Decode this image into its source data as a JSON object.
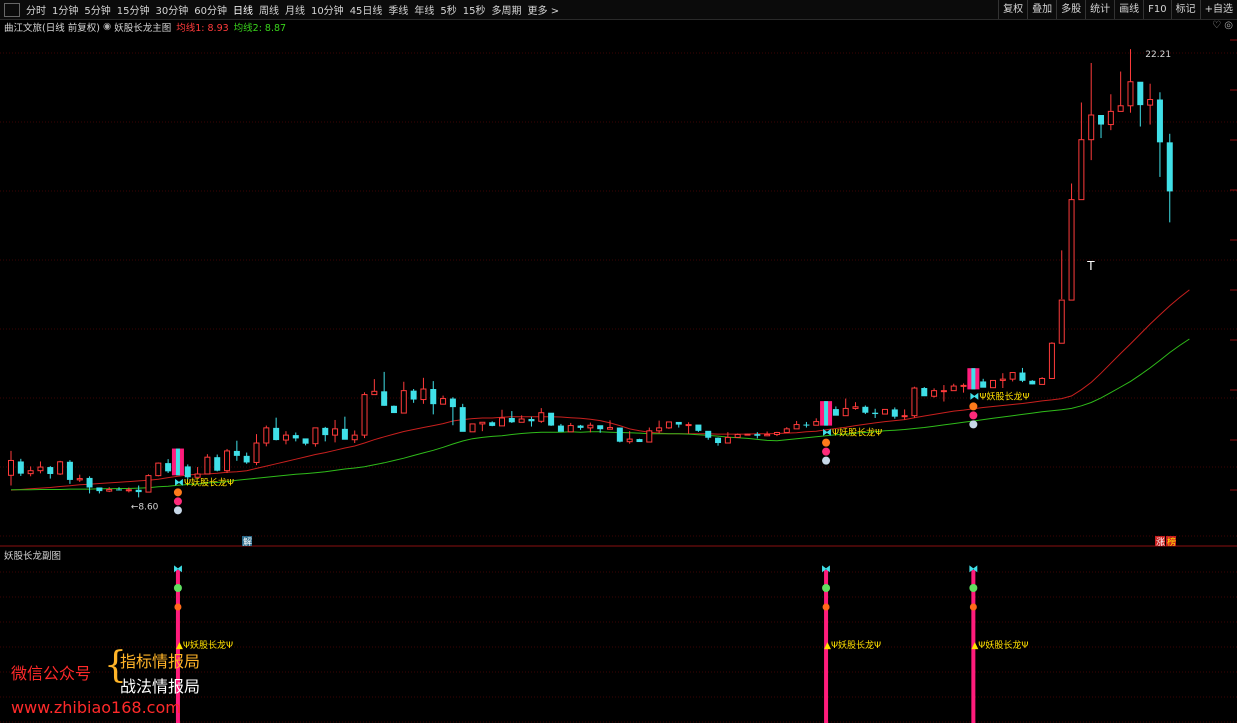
{
  "toolbar": {
    "left_items": [
      "分时",
      "1分钟",
      "5分钟",
      "15分钟",
      "30分钟",
      "60分钟",
      "日线",
      "周线",
      "月线",
      "10分钟",
      "45日线",
      "季线",
      "年线",
      "5秒",
      "15秒",
      "多周期",
      "更多 >"
    ],
    "active_item": "日线",
    "right_items": [
      "复权",
      "叠加",
      "多股",
      "统计",
      "画线",
      "F10",
      "标记",
      "+自选"
    ]
  },
  "title": {
    "stock": "曲江文旅(日线 前复权)",
    "indicator": "妖股长龙主图",
    "ma1": "均线1: 8.93",
    "ma2": "均线2: 8.87",
    "icons": "♡ ◎"
  },
  "sub": {
    "title": "妖股长龙副图"
  },
  "colors": {
    "up": "#ff3b3b",
    "down": "#40e0e8",
    "ma1": "#c8201e",
    "ma2": "#2fbb1a",
    "signal_bar": "#ff1c7c",
    "signal_text": "#ffe000",
    "grid": "#7a0a0a"
  },
  "chart_data": {
    "type": "candlestick",
    "ylim": [
      7.7,
      22.7
    ],
    "candles": [
      [
        9.27,
        9.72,
        8.96,
        10.01
      ],
      [
        9.69,
        9.32,
        9.25,
        9.77
      ],
      [
        9.32,
        9.41,
        9.24,
        9.54
      ],
      [
        9.41,
        9.52,
        9.33,
        9.69
      ],
      [
        9.52,
        9.31,
        9.17,
        9.55
      ],
      [
        9.31,
        9.68,
        9.28,
        9.71
      ],
      [
        9.68,
        9.13,
        9.01,
        9.73
      ],
      [
        9.13,
        9.17,
        9.07,
        9.29
      ],
      [
        9.19,
        8.9,
        8.72,
        9.24
      ],
      [
        8.9,
        8.79,
        8.72,
        8.9
      ],
      [
        8.79,
        8.84,
        8.76,
        8.91
      ],
      [
        8.84,
        8.82,
        8.81,
        8.91
      ],
      [
        8.82,
        8.83,
        8.75,
        8.9
      ],
      [
        8.83,
        8.76,
        8.6,
        8.96
      ],
      [
        8.76,
        9.26,
        8.75,
        9.3
      ],
      [
        9.26,
        9.64,
        9.24,
        9.66
      ],
      [
        9.64,
        9.39,
        9.34,
        9.76
      ],
      [
        9.39,
        9.54,
        9.31,
        9.9
      ],
      [
        9.54,
        9.21,
        9.15,
        9.6
      ],
      [
        9.21,
        9.31,
        9.22,
        9.52
      ],
      [
        9.31,
        9.82,
        9.3,
        9.91
      ],
      [
        9.82,
        9.41,
        9.39,
        9.9
      ],
      [
        9.41,
        10.01,
        9.34,
        10.07
      ],
      [
        10.01,
        9.86,
        9.71,
        10.32
      ],
      [
        9.86,
        9.66,
        9.62,
        9.96
      ],
      [
        9.66,
        10.25,
        9.58,
        10.52
      ],
      [
        10.25,
        10.71,
        10.15,
        10.78
      ],
      [
        10.71,
        10.34,
        10.33,
        11.02
      ],
      [
        10.34,
        10.49,
        10.21,
        10.61
      ],
      [
        10.49,
        10.39,
        10.3,
        10.57
      ],
      [
        10.39,
        10.23,
        10.18,
        10.36
      ],
      [
        10.23,
        10.71,
        10.14,
        10.72
      ],
      [
        10.71,
        10.49,
        10.3,
        10.74
      ],
      [
        10.49,
        10.68,
        10.27,
        10.95
      ],
      [
        10.68,
        10.35,
        10.39,
        11.05
      ],
      [
        10.35,
        10.49,
        10.25,
        10.63
      ],
      [
        10.49,
        11.72,
        10.4,
        11.79
      ],
      [
        11.72,
        11.82,
        11.77,
        12.19
      ],
      [
        11.82,
        11.38,
        11.38,
        12.41
      ],
      [
        11.38,
        11.16,
        11.16,
        11.39
      ],
      [
        11.16,
        11.84,
        11.23,
        12.11
      ],
      [
        11.84,
        11.57,
        11.47,
        11.89
      ],
      [
        11.57,
        11.89,
        11.44,
        12.23
      ],
      [
        11.89,
        11.43,
        11.12,
        12.13
      ],
      [
        11.43,
        11.6,
        11.48,
        11.69
      ],
      [
        11.6,
        11.34,
        10.79,
        11.64
      ],
      [
        11.34,
        10.59,
        10.75,
        11.44
      ],
      [
        10.59,
        10.83,
        10.67,
        10.83
      ],
      [
        10.83,
        10.88,
        10.61,
        10.88
      ],
      [
        10.88,
        10.77,
        10.76,
        10.91
      ],
      [
        10.77,
        11.01,
        10.82,
        11.26
      ],
      [
        11.01,
        10.88,
        10.86,
        11.22
      ],
      [
        10.88,
        10.98,
        10.92,
        11.09
      ],
      [
        10.98,
        10.91,
        10.75,
        11.05
      ],
      [
        10.91,
        11.17,
        10.86,
        11.31
      ],
      [
        11.17,
        10.78,
        10.77,
        10.99
      ],
      [
        10.78,
        10.59,
        10.62,
        10.83
      ],
      [
        10.59,
        10.78,
        10.71,
        10.86
      ],
      [
        10.78,
        10.71,
        10.65,
        10.8
      ],
      [
        10.71,
        10.79,
        10.57,
        10.87
      ],
      [
        10.79,
        10.67,
        10.56,
        10.72
      ],
      [
        10.67,
        10.72,
        10.67,
        10.94
      ],
      [
        10.72,
        10.29,
        10.27,
        10.72
      ],
      [
        10.29,
        10.37,
        10.23,
        10.61
      ],
      [
        10.37,
        10.28,
        10.29,
        10.38
      ],
      [
        10.28,
        10.62,
        10.27,
        10.72
      ],
      [
        10.62,
        10.71,
        10.55,
        10.93
      ],
      [
        10.71,
        10.89,
        10.68,
        10.89
      ],
      [
        10.89,
        10.81,
        10.72,
        10.82
      ],
      [
        10.81,
        10.81,
        10.53,
        10.88
      ],
      [
        10.81,
        10.62,
        10.59,
        10.74
      ],
      [
        10.62,
        10.41,
        10.35,
        10.59
      ],
      [
        10.41,
        10.25,
        10.17,
        10.42
      ],
      [
        10.25,
        10.42,
        10.35,
        10.58
      ],
      [
        10.42,
        10.51,
        10.43,
        10.54
      ],
      [
        10.51,
        10.52,
        10.53,
        10.54
      ],
      [
        10.52,
        10.47,
        10.39,
        10.58
      ],
      [
        10.47,
        10.51,
        10.46,
        10.6
      ],
      [
        10.51,
        10.57,
        10.46,
        10.59
      ],
      [
        10.57,
        10.68,
        10.57,
        10.73
      ],
      [
        10.68,
        10.81,
        10.71,
        10.92
      ],
      [
        10.81,
        10.79,
        10.72,
        10.89
      ],
      [
        10.79,
        10.9,
        10.85,
        11.0
      ],
      [
        10.9,
        11.28,
        10.85,
        11.34
      ],
      [
        11.28,
        11.08,
        11.11,
        11.36
      ],
      [
        11.08,
        11.3,
        11.15,
        11.6
      ],
      [
        11.3,
        11.35,
        11.26,
        11.49
      ],
      [
        11.35,
        11.17,
        11.13,
        11.39
      ],
      [
        11.17,
        11.13,
        11.01,
        11.29
      ],
      [
        11.13,
        11.27,
        11.13,
        11.28
      ],
      [
        11.27,
        11.05,
        10.99,
        11.33
      ],
      [
        11.05,
        11.08,
        10.96,
        11.27
      ],
      [
        11.08,
        11.92,
        11.02,
        11.96
      ],
      [
        11.92,
        11.67,
        11.69,
        11.95
      ],
      [
        11.67,
        11.84,
        11.63,
        11.91
      ],
      [
        11.84,
        11.84,
        11.51,
        12.01
      ],
      [
        11.84,
        11.98,
        11.86,
        12.05
      ],
      [
        11.98,
        12.0,
        11.78,
        12.06
      ],
      [
        12.0,
        12.12,
        12.01,
        12.34
      ],
      [
        12.12,
        11.93,
        11.97,
        12.2
      ],
      [
        11.93,
        12.15,
        12.02,
        12.15
      ],
      [
        12.15,
        12.19,
        11.92,
        12.37
      ],
      [
        12.19,
        12.39,
        12.12,
        12.4
      ],
      [
        12.39,
        12.14,
        12.1,
        12.53
      ],
      [
        12.14,
        12.03,
        12.03,
        12.16
      ],
      [
        12.03,
        12.21,
        12.06,
        12.25
      ],
      [
        12.21,
        13.28,
        12.27,
        13.31
      ],
      [
        13.28,
        14.59,
        14.62,
        16.1
      ],
      [
        14.59,
        17.64,
        17.31,
        18.13
      ],
      [
        17.64,
        19.46,
        18.69,
        20.59
      ],
      [
        19.46,
        20.21,
        18.84,
        21.79
      ],
      [
        20.21,
        19.92,
        19.51,
        20.05
      ],
      [
        19.92,
        20.32,
        19.75,
        20.84
      ],
      [
        20.32,
        20.49,
        20.43,
        21.53
      ],
      [
        20.49,
        21.22,
        20.28,
        22.21
      ],
      [
        21.22,
        20.51,
        19.86,
        20.74
      ],
      [
        20.51,
        20.68,
        19.92,
        21.16
      ],
      [
        20.68,
        19.38,
        18.33,
        20.9
      ],
      [
        19.38,
        17.89,
        16.95,
        19.64
      ]
    ],
    "ma1": [
      8.82,
      8.84,
      8.86,
      8.88,
      8.9,
      8.93,
      8.95,
      8.98,
      9.0,
      9.02,
      9.04,
      9.06,
      9.08,
      9.1,
      9.12,
      9.15,
      9.2,
      9.24,
      9.28,
      9.3,
      9.31,
      9.33,
      9.36,
      9.38,
      9.41,
      9.48,
      9.55,
      9.62,
      9.69,
      9.76,
      9.83,
      9.9,
      9.96,
      10.03,
      10.1,
      10.16,
      10.25,
      10.35,
      10.44,
      10.52,
      10.6,
      10.66,
      10.72,
      10.78,
      10.84,
      10.92,
      10.96,
      10.99,
      11.01,
      11.01,
      11.03,
      11.05,
      11.05,
      11.05,
      11.05,
      11.05,
      11.04,
      11.02,
      11.0,
      10.97,
      10.93,
      10.86,
      10.78,
      10.68,
      10.62,
      10.58,
      10.55,
      10.53,
      10.53,
      10.53,
      10.53,
      10.53,
      10.52,
      10.52,
      10.52,
      10.52,
      10.53,
      10.53,
      10.54,
      10.55,
      10.56,
      10.59,
      10.61,
      10.65,
      10.69,
      10.73,
      10.78,
      10.82,
      10.86,
      10.9,
      10.93,
      10.96,
      11.02,
      11.07,
      11.12,
      11.17,
      11.22,
      11.25,
      11.29,
      11.33,
      11.36,
      11.39,
      11.42,
      11.45,
      11.49,
      11.53,
      11.56,
      11.6,
      11.68,
      11.87,
      12.09,
      12.37,
      12.67,
      12.97,
      13.26,
      13.56,
      13.86,
      14.14,
      14.42,
      14.67,
      14.9
    ],
    "ma2": [
      8.83,
      8.83,
      8.83,
      8.84,
      8.84,
      8.84,
      8.85,
      8.85,
      8.85,
      8.86,
      8.86,
      8.87,
      8.87,
      8.88,
      8.89,
      8.92,
      8.94,
      8.97,
      8.99,
      9.01,
      9.04,
      9.05,
      9.08,
      9.12,
      9.15,
      9.18,
      9.21,
      9.24,
      9.27,
      9.3,
      9.32,
      9.35,
      9.38,
      9.42,
      9.46,
      9.49,
      9.53,
      9.59,
      9.65,
      9.72,
      9.79,
      9.87,
      9.95,
      10.03,
      10.12,
      10.22,
      10.31,
      10.38,
      10.42,
      10.45,
      10.47,
      10.51,
      10.54,
      10.56,
      10.58,
      10.58,
      10.58,
      10.59,
      10.58,
      10.59,
      10.59,
      10.58,
      10.57,
      10.56,
      10.55,
      10.53,
      10.53,
      10.53,
      10.53,
      10.52,
      10.5,
      10.48,
      10.46,
      10.43,
      10.41,
      10.39,
      10.36,
      10.33,
      10.32,
      10.35,
      10.38,
      10.41,
      10.44,
      10.47,
      10.5,
      10.52,
      10.55,
      10.57,
      10.59,
      10.62,
      10.64,
      10.66,
      10.69,
      10.72,
      10.76,
      10.8,
      10.84,
      10.88,
      10.92,
      10.96,
      11.0,
      11.04,
      11.08,
      11.12,
      11.16,
      11.2,
      11.23,
      11.26,
      11.3,
      11.38,
      11.48,
      11.62,
      11.78,
      11.95,
      12.12,
      12.32,
      12.53,
      12.76,
      13.0,
      13.21,
      13.41
    ],
    "signals": [
      17,
      83,
      98
    ],
    "signal_label": "Ψ妖股长龙Ψ",
    "sub_label": "Ψ妖股长龙Ψ",
    "low_label": "←8.60",
    "high_label": "22.21",
    "marker_jie": "解",
    "marker_zt": "涨",
    "marker_zt2": "榜",
    "t_mark": "T"
  },
  "watermark": {
    "line1": "微信公众号",
    "line2": "指标情报局",
    "line3": "战法情报局",
    "url": "www.zhibiao168.com"
  }
}
